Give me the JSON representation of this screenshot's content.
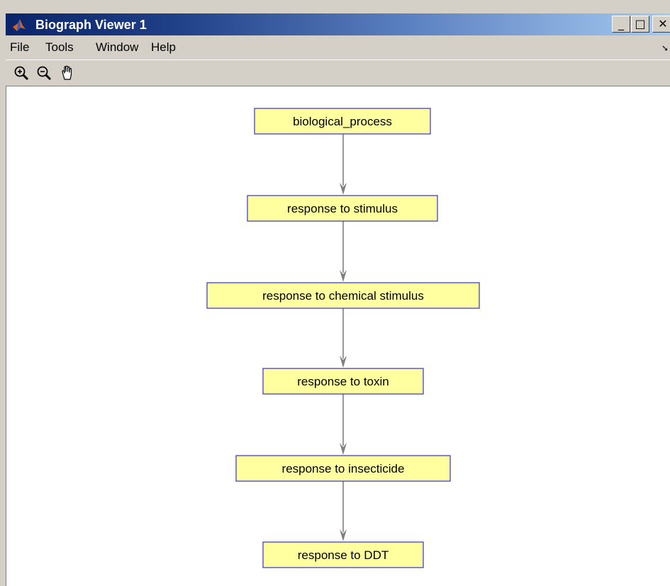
{
  "window": {
    "title": "Biograph Viewer 1"
  },
  "titlebar": {
    "minimize_symbol": "_",
    "maximize_symbol": "□",
    "close_symbol": "✕"
  },
  "menubar": {
    "items": [
      "File",
      "Tools",
      "Window",
      "Help"
    ]
  },
  "toolbar": {
    "icons": [
      "zoom-in-icon",
      "zoom-out-icon",
      "pan-hand-icon"
    ]
  },
  "graph": {
    "node_fill": "#ffffa0",
    "node_stroke": "#3333cc",
    "edge_color": "#808080",
    "nodes": [
      {
        "label": "biological_process"
      },
      {
        "label": "response to stimulus"
      },
      {
        "label": "response to chemical stimulus"
      },
      {
        "label": "response to toxin"
      },
      {
        "label": "response to insecticide"
      },
      {
        "label": "response to DDT"
      }
    ],
    "edges": [
      {
        "from": "biological_process",
        "to": "response to stimulus"
      },
      {
        "from": "response to stimulus",
        "to": "response to chemical stimulus"
      },
      {
        "from": "response to chemical stimulus",
        "to": "response to toxin"
      },
      {
        "from": "response to toxin",
        "to": "response to insecticide"
      },
      {
        "from": "response to insecticide",
        "to": "response to DDT"
      }
    ]
  }
}
